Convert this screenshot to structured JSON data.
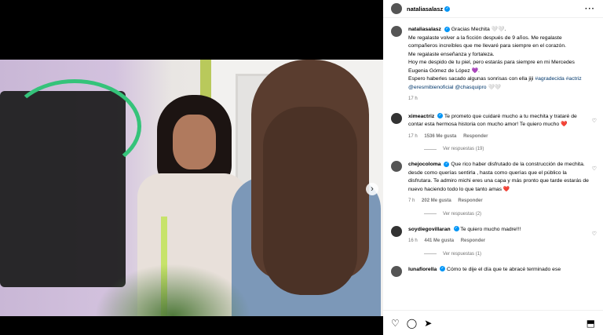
{
  "post": {
    "username": "nataliasalasz",
    "caption_lines": [
      "Gracias Mechita 🤍🤍.",
      "Me regalaste volver a la ficción después de 9 años. Me regalaste compañeros increíbles que me llevaré para siempre en el corazón.",
      "Me regalaste enseñanza y fortaleza.",
      "Hoy me despido de tu piel, pero estarás para siempre en mi Mercedes Eugenia Gómez de López 💜.",
      "Espero haberles sacado algunas sonrisas con ella jiji"
    ],
    "hashtags": "#agradecida #actriz",
    "mentions": "@eresmibienoficial @chasquipro 🤍🤍",
    "time": "17 h"
  },
  "comments": [
    {
      "username": "ximeactriz",
      "text": "Te prometo que cuidaré mucho a tu mechita y trataré de contar esta hermosa historia con mucho amor! Te quiero mucho ❤️",
      "time": "17 h",
      "likes": "1536 Me gusta",
      "reply": "Responder",
      "replies": "Ver respuestas (19)"
    },
    {
      "username": "chejocoloma",
      "text": "Que rico haber disfrutado de la construcción de mechita. desde como querías sentirla , hasta como querías que el público la disfrutara. Te admiro michi eres una capa y más pronto que tarde estarás de nuevo haciendo todo lo que tanto amas ❤️",
      "time": "7 h",
      "likes": "202 Me gusta",
      "reply": "Responder",
      "replies": "Ver respuestas (2)"
    },
    {
      "username": "soydiegovillaran",
      "text": "Te quiero mucho madre!!!",
      "time": "16 h",
      "likes": "441 Me gusta",
      "reply": "Responder",
      "replies": "Ver respuestas (1)"
    },
    {
      "username": "lunafiorella",
      "text": "Cómo te dije el día que te abracé terminado ese"
    }
  ],
  "icons": [
    "heart-icon",
    "comment-icon",
    "share-icon",
    "save-icon",
    "more-icon",
    "verified-icon",
    "next-arrow-icon"
  ]
}
